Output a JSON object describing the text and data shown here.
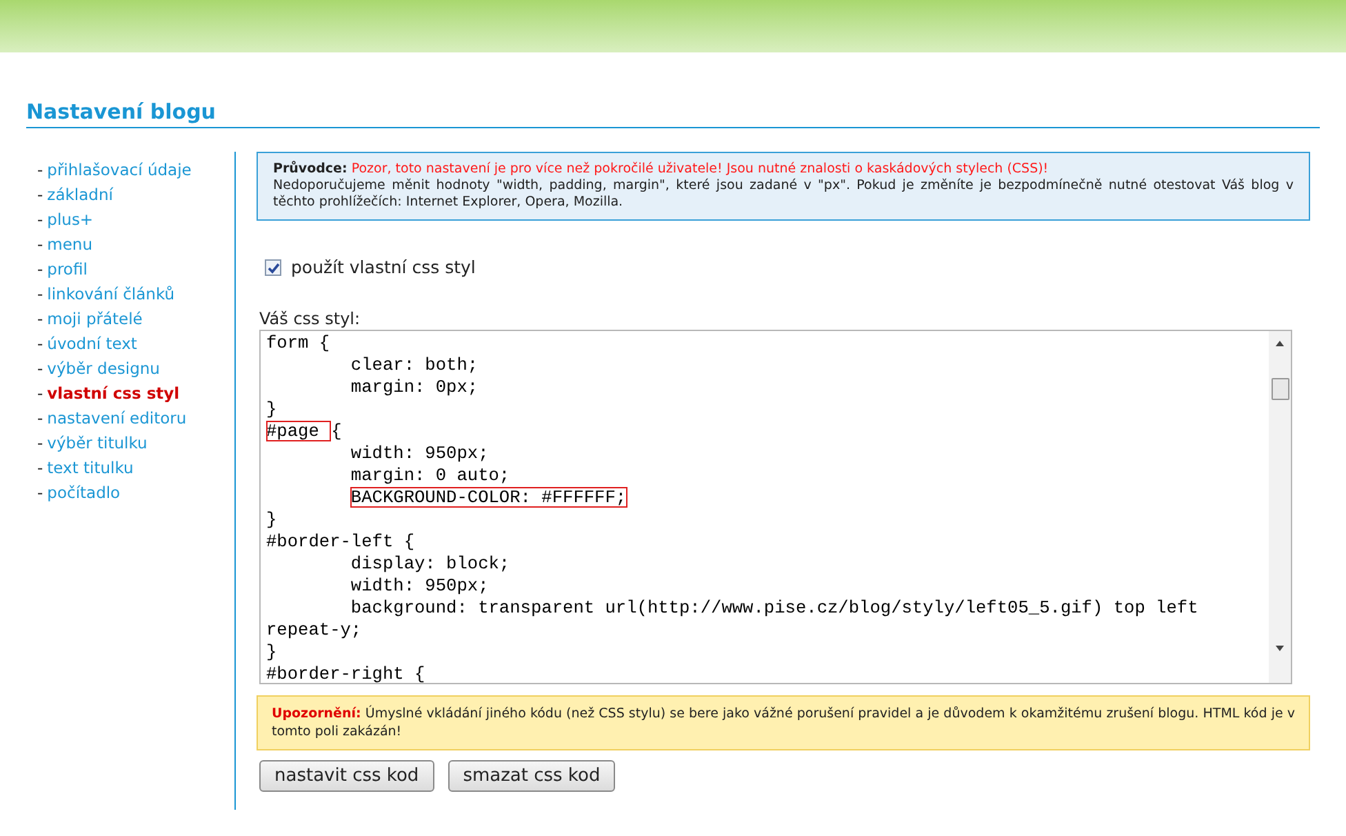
{
  "page_title": "Nastavení blogu",
  "sidebar": {
    "items": [
      {
        "bullet": "-",
        "label": "přihlašovací údaje",
        "selected": false
      },
      {
        "bullet": "-",
        "label": "základní",
        "selected": false
      },
      {
        "bullet": "-",
        "label": "plus+",
        "selected": false
      },
      {
        "bullet": "-",
        "label": "menu",
        "selected": false
      },
      {
        "bullet": "-",
        "label": "profil",
        "selected": false
      },
      {
        "bullet": "-",
        "label": "linkování článků",
        "selected": false
      },
      {
        "bullet": "-",
        "label": "moji přátelé",
        "selected": false
      },
      {
        "bullet": "-",
        "label": "úvodní text",
        "selected": false
      },
      {
        "bullet": "-",
        "label": "výběr designu",
        "selected": false
      },
      {
        "bullet": "-",
        "label": "vlastní css styl",
        "selected": true
      },
      {
        "bullet": "-",
        "label": "nastavení editoru",
        "selected": false
      },
      {
        "bullet": "-",
        "label": "výběr titulku",
        "selected": false
      },
      {
        "bullet": "-",
        "label": "text titulku",
        "selected": false
      },
      {
        "bullet": "-",
        "label": "počítadlo",
        "selected": false
      }
    ]
  },
  "guide": {
    "label": "Průvodce:",
    "warning": "Pozor, toto nastavení je pro více než pokročilé uživatele! Jsou nutné znalosti o kaskádových stylech (CSS)!",
    "text": "Nedoporučujeme měnit hodnoty \"width, padding, margin\", které jsou zadané v \"px\". Pokud je změníte je bezpodmínečně nutné otestovat Váš blog v těchto prohlížečích: Internet Explorer, Opera, Mozilla."
  },
  "use_custom_css": {
    "label": "použít vlastní css styl",
    "checked": true
  },
  "css_editor": {
    "label": "Váš css styl:",
    "lines": [
      {
        "indent": false,
        "parts": [
          {
            "text": "form {",
            "boxed": false
          }
        ]
      },
      {
        "indent": true,
        "parts": [
          {
            "text": "clear: both;",
            "boxed": false
          }
        ]
      },
      {
        "indent": true,
        "parts": [
          {
            "text": "margin: 0px;",
            "boxed": false
          }
        ]
      },
      {
        "indent": false,
        "parts": [
          {
            "text": "}",
            "boxed": false
          }
        ]
      },
      {
        "indent": false,
        "parts": [
          {
            "text": "#page ",
            "boxed": true
          },
          {
            "text": "{",
            "boxed": false
          }
        ]
      },
      {
        "indent": true,
        "parts": [
          {
            "text": "width: 950px;",
            "boxed": false
          }
        ]
      },
      {
        "indent": true,
        "parts": [
          {
            "text": "margin: 0 auto;",
            "boxed": false
          }
        ]
      },
      {
        "indent": true,
        "parts": [
          {
            "text": "BACKGROUND-COLOR: #FFFFFF;",
            "boxed": true
          }
        ]
      },
      {
        "indent": false,
        "parts": [
          {
            "text": "}",
            "boxed": false
          }
        ]
      },
      {
        "indent": false,
        "parts": [
          {
            "text": "#border-left {",
            "boxed": false
          }
        ]
      },
      {
        "indent": true,
        "parts": [
          {
            "text": "display: block;",
            "boxed": false
          }
        ]
      },
      {
        "indent": true,
        "parts": [
          {
            "text": "width: 950px;",
            "boxed": false
          }
        ]
      },
      {
        "indent": true,
        "parts": [
          {
            "text": "background: transparent url(http://www.pise.cz/blog/styly/left05_5.gif) top left",
            "boxed": false
          }
        ]
      },
      {
        "indent": false,
        "parts": [
          {
            "text": "repeat-y;",
            "boxed": false
          }
        ]
      },
      {
        "indent": false,
        "parts": [
          {
            "text": "}",
            "boxed": false
          }
        ]
      },
      {
        "indent": false,
        "parts": [
          {
            "text": "#border-right {",
            "boxed": false
          }
        ]
      }
    ]
  },
  "notice": {
    "label": "Upozornění:",
    "text": "Úmyslné vkládání jiného kódu (než CSS stylu) se bere jako vážné porušení pravidel a je důvodem k okamžitému zrušení blogu. HTML kód je v tomto poli zakázán!"
  },
  "buttons": [
    "nastavit css kod",
    "smazat css kod"
  ]
}
